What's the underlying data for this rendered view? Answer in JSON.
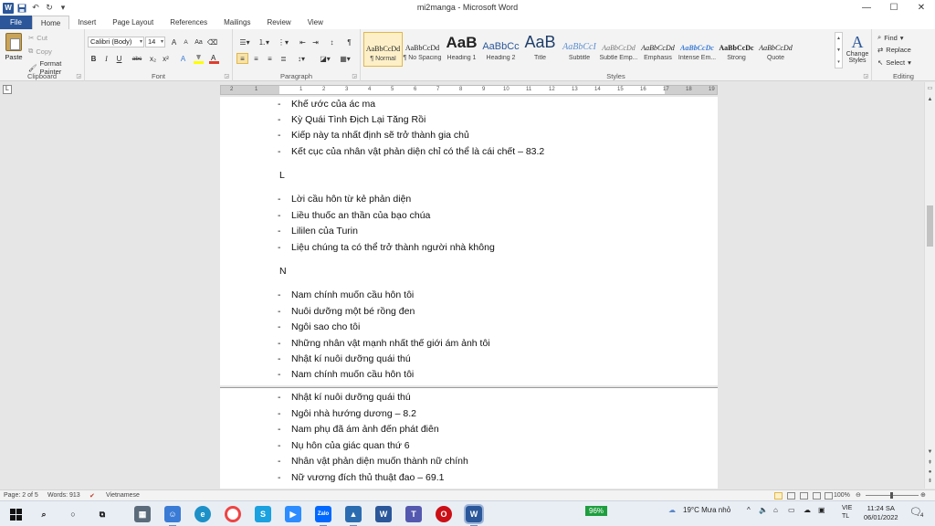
{
  "window": {
    "title": "mi2manga - Microsoft Word",
    "qat": {
      "save_icon": "save-icon",
      "undo_icon": "undo-icon",
      "redo_icon": "redo-icon"
    },
    "controls": {
      "minimize": "—",
      "maximize": "☐",
      "close": "✕"
    }
  },
  "tabs": [
    "File",
    "Home",
    "Insert",
    "Page Layout",
    "References",
    "Mailings",
    "Review",
    "View"
  ],
  "ribbon": {
    "clipboard": {
      "label": "Clipboard",
      "paste": "Paste",
      "cut": "Cut",
      "copy": "Copy",
      "format_painter": "Format Painter"
    },
    "font": {
      "label": "Font",
      "font_name": "Calibri (Body)",
      "font_size": "14",
      "bold": "B",
      "italic": "I",
      "underline": "U",
      "strike": "abc",
      "subscript": "x₂",
      "superscript": "x²",
      "grow": "A",
      "shrink": "A",
      "change_case": "Aa",
      "highlight_color": "#ffff00",
      "font_color": "#e03c2c"
    },
    "paragraph": {
      "label": "Paragraph"
    },
    "styles": {
      "label": "Styles",
      "items": [
        {
          "preview": "AaBbCcDd",
          "name": "¶ Normal"
        },
        {
          "preview": "AaBbCcDd",
          "name": "¶ No Spacing"
        },
        {
          "preview": "AaB",
          "name": "Heading 1"
        },
        {
          "preview": "AaBbCc",
          "name": "Heading 2"
        },
        {
          "preview": "AaB",
          "name": "Title"
        },
        {
          "preview": "AaBbCcI",
          "name": "Subtitle"
        },
        {
          "preview": "AaBbCcDd",
          "name": "Subtle Emp..."
        },
        {
          "preview": "AaBbCcDd",
          "name": "Emphasis"
        },
        {
          "preview": "AaBbCcDc",
          "name": "Intense Em..."
        },
        {
          "preview": "AaBbCcDc",
          "name": "Strong"
        },
        {
          "preview": "AaBbCcDd",
          "name": "Quote"
        }
      ],
      "change_styles": "Change Styles",
      "change_styles_glyph": "A"
    },
    "editing": {
      "label": "Editing",
      "find": "Find",
      "replace": "Replace",
      "select": "Select"
    }
  },
  "ruler": {
    "corner": "L",
    "ticks": [
      "2",
      "1",
      "1",
      "2",
      "3",
      "4",
      "5",
      "6",
      "7",
      "8",
      "9",
      "10",
      "11",
      "12",
      "13",
      "14",
      "15",
      "16",
      "17",
      "18",
      "19"
    ]
  },
  "document": {
    "page1": {
      "group_k_items": [
        "Khế ước của ác ma",
        "Kỳ Quái Tình Địch Lại Tăng Rồi",
        "Kiếp này ta nhất định sẽ trở thành gia chủ",
        "Kết cục của nhân vật phản diện chỉ có thể là cái chết – 83.2"
      ],
      "letter_l": "L",
      "group_l_items": [
        "Lời cầu hôn từ kẻ phản diện",
        "Liều thuốc an thần của bạo  chúa",
        "Lililen của Turin",
        "Liệu chúng ta có thể trở thành người nhà không"
      ],
      "letter_n": "N",
      "group_n_items": [
        "Nam chính muốn cầu hôn tôi",
        "Nuôi dưỡng một bé rồng đen",
        "Ngôi sao cho tôi",
        "Những nhân vật mạnh nhất thế giới ám ảnh tôi",
        "Nhật kí nuôi dưỡng quái thú",
        "Nam chính muốn cầu hôn tôi"
      ]
    },
    "page2": {
      "items": [
        "Nhật kí nuôi dưỡng quái thú",
        "Ngôi nhà hướng dương – 8.2",
        "Nam phụ đã ám ảnh đến phát điên",
        "Nụ hôn của giác quan thứ 6",
        "Nhân vật phản diện muốn thành nữ chính",
        "Nữ vương đích thủ thuật đao – 69.1"
      ]
    },
    "bullet": "-"
  },
  "statusbar": {
    "page": "Page: 2 of 5",
    "words": "Words: 913",
    "language": "Vietnamese",
    "zoom": "100%"
  },
  "taskbar": {
    "battery": "96%",
    "weather": "19°C  Mưa nhỏ",
    "lang_top": "VIE",
    "lang_bottom": "TL",
    "time": "11:24 SA",
    "date": "06/01/2022",
    "notifications": "4"
  }
}
